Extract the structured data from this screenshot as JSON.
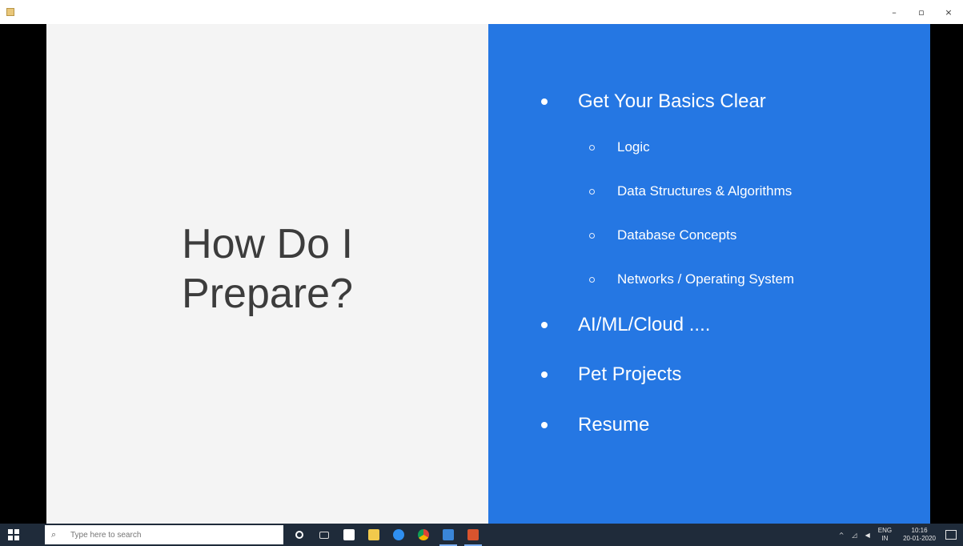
{
  "window": {
    "controls": [
      "–",
      "▫",
      "×"
    ]
  },
  "slide": {
    "title_lines": [
      "How Do I",
      "Prepare?"
    ],
    "bullets": [
      {
        "label": "Get Your Basics Clear"
      },
      {
        "label": "AI/ML/Cloud ...."
      },
      {
        "label": "Pet Projects"
      },
      {
        "label": "Resume"
      }
    ],
    "sub_bullets": [
      {
        "label": "Logic"
      },
      {
        "label": "Data Structures & Algorithms"
      },
      {
        "label": "Database Concepts"
      },
      {
        "label": "Networks / Operating System"
      }
    ],
    "colors": {
      "left_bg": "#f4f4f4",
      "right_bg": "#2577e3",
      "title_color": "#3c3c3c"
    }
  },
  "taskbar": {
    "search_placeholder": "Type here to search",
    "apps": [
      {
        "icon": "cortana-icon",
        "color": "#ffffff"
      },
      {
        "icon": "task-view-icon",
        "color": "#d8d8d8"
      },
      {
        "icon": "store-icon",
        "color": "#ffffff"
      },
      {
        "icon": "file-explorer-icon",
        "color": "#f2c94c"
      },
      {
        "icon": "edge-icon",
        "color": "#2f8ff0"
      },
      {
        "icon": "chrome-icon",
        "color": "#e8b12c"
      },
      {
        "icon": "photos-icon",
        "color": "#3a86d9"
      },
      {
        "icon": "media-player-icon",
        "color": "#d9542e"
      }
    ],
    "tray": {
      "lang_top": "ENG",
      "lang_bottom": "IN",
      "time": "10:16",
      "date": "20-01-2020"
    }
  }
}
